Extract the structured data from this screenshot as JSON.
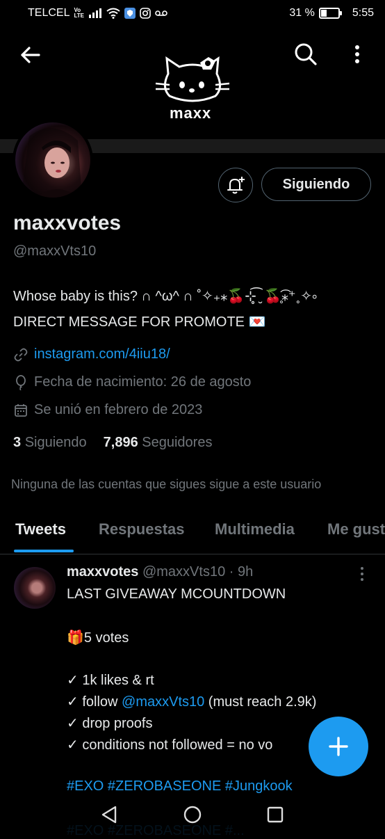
{
  "status_bar": {
    "carrier": "TELCEL",
    "volte_top": "Vo",
    "volte_bottom": "LTE",
    "battery": "31 %",
    "time": "5:55"
  },
  "banner": {
    "name": "maxx"
  },
  "icons": {
    "back": "arrow-left-icon",
    "search": "search-icon",
    "more": "more-vertical-icon",
    "bell": "bell-plus-icon",
    "link": "link-icon",
    "birthday": "balloon-icon",
    "calendar": "calendar-icon",
    "fab": "plus-icon"
  },
  "profile": {
    "follow_button": "Siguiendo",
    "display_name": "maxxvotes",
    "handle": "@maxxVts10",
    "bio_line1": "Whose baby is this? ∩ ^ω^ ∩ ˚✧₊⁎🍒⊹̥͡ ̮ 🍒̥͡⁎⁺˳✧༚",
    "bio_line2": "DIRECT MESSAGE FOR PROMOTE 💌",
    "website": "instagram.com/4iiu18/",
    "birthday": "Fecha de nacimiento: 26 de agosto",
    "joined": "Se unió en febrero de 2023",
    "following_count": "3",
    "following_label": "Siguiendo",
    "followers_count": "7,896",
    "followers_label": "Seguidores",
    "followers_note": "Ninguna de las cuentas que sigues sigue a este usuario"
  },
  "tabs": [
    "Tweets",
    "Respuestas",
    "Multimedia",
    "Me gust"
  ],
  "tweet": {
    "name": "maxxvotes",
    "handle": "@maxxVts10",
    "time": "· 9h",
    "line1": "LAST GIVEAWAY MCOUNTDOWN",
    "line2": "🎁5 votes",
    "line3": "✓ 1k likes & rt",
    "line4_pre": "✓ follow ",
    "line4_mention": "@maxxVts10",
    "line4_post": " (must reach 2.9k)",
    "line5": " ✓ drop proofs",
    "line6": "✓ conditions not followed = no vo",
    "hashtags": "#EXO #ZEROBASEONE #Jungkook",
    "hashtags_next": "#EXO #ZEROBASEONE #..."
  }
}
